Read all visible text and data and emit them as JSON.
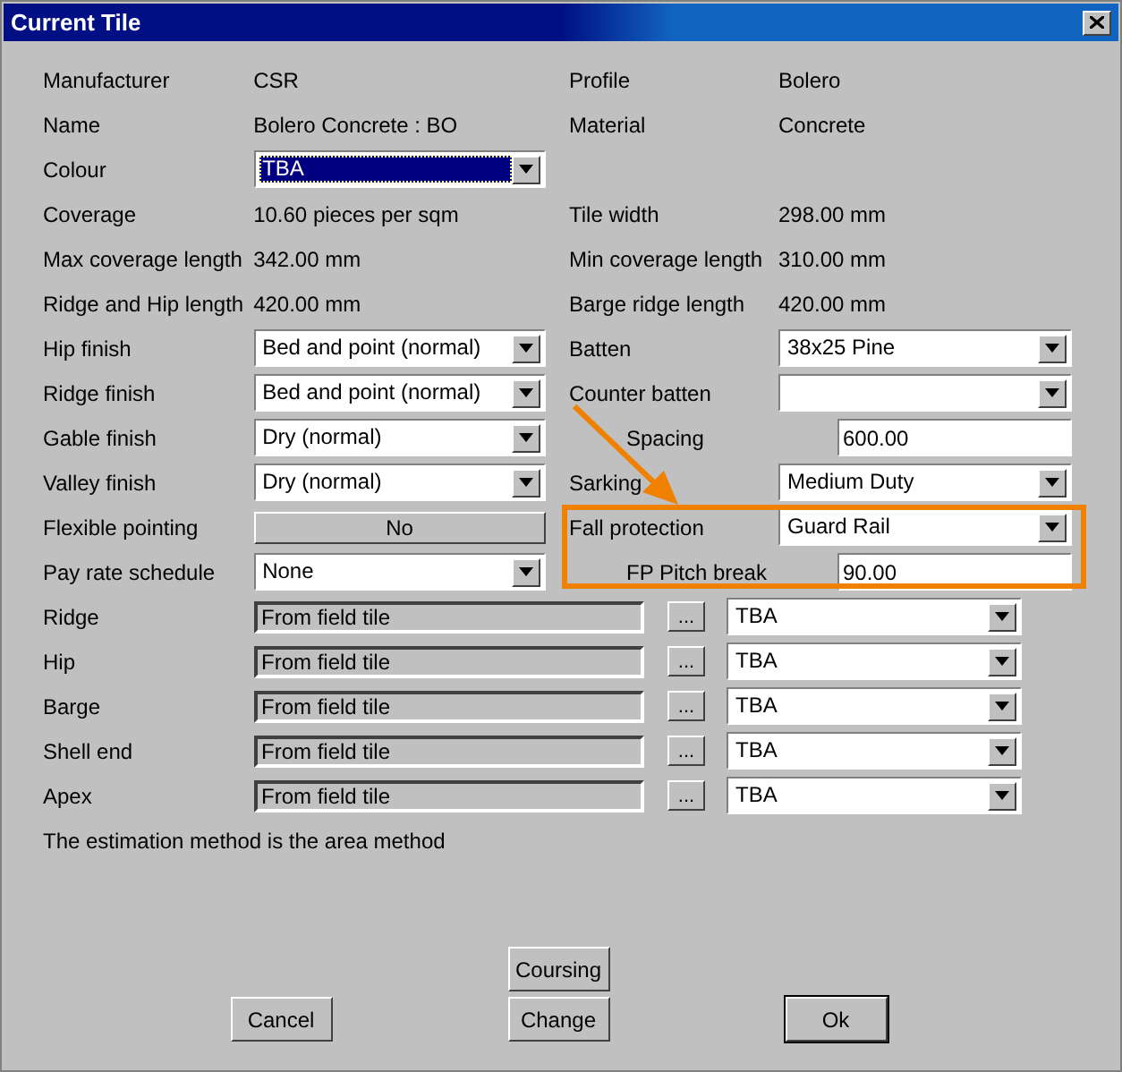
{
  "window": {
    "title": "Current Tile"
  },
  "rows": [
    {
      "left": {
        "label": "Manufacturer",
        "kind": "text",
        "value": "CSR"
      },
      "right": {
        "label": "Profile",
        "kind": "text",
        "value": "Bolero"
      }
    },
    {
      "left": {
        "label": "Name",
        "kind": "text",
        "value": "Bolero Concrete : BO"
      },
      "right": {
        "label": "Material",
        "kind": "text",
        "value": "Concrete"
      }
    },
    {
      "left": {
        "label": "Colour",
        "kind": "select",
        "value": "TBA",
        "focused": true
      }
    },
    {
      "left": {
        "label": "Coverage",
        "kind": "text",
        "value": "10.60 pieces per sqm"
      },
      "right": {
        "label": "Tile width",
        "kind": "text",
        "value": "298.00 mm"
      }
    },
    {
      "left": {
        "label": "Max coverage length",
        "kind": "text",
        "value": "342.00 mm"
      },
      "right": {
        "label": "Min coverage length",
        "kind": "text",
        "value": "310.00 mm"
      }
    },
    {
      "left": {
        "label": "Ridge and Hip length",
        "kind": "text",
        "value": "420.00 mm"
      },
      "right": {
        "label": "Barge ridge length",
        "kind": "text",
        "value": "420.00 mm"
      }
    },
    {
      "left": {
        "label": "Hip finish",
        "kind": "select",
        "value": "Bed and point (normal)",
        "focused": false
      },
      "right": {
        "label": "Batten",
        "kind": "select",
        "value": "38x25 Pine",
        "focused": false
      }
    },
    {
      "left": {
        "label": "Ridge finish",
        "kind": "select",
        "value": "Bed and point (normal)",
        "focused": false
      },
      "right": {
        "label": "Counter batten",
        "kind": "select",
        "focused": false
      }
    },
    {
      "left": {
        "label": "Gable finish",
        "kind": "select",
        "value": "Dry (normal)",
        "focused": false
      },
      "right": {
        "label": "Spacing",
        "kind": "input",
        "value": "600.00"
      }
    },
    {
      "left": {
        "label": "Valley  finish",
        "kind": "select",
        "value": "Dry (normal)",
        "focused": false
      },
      "right": {
        "label": "Sarking",
        "kind": "select",
        "value": "Medium Duty",
        "focused": false
      }
    },
    {
      "left": {
        "label": "Flexible pointing",
        "kind": "toggle",
        "value": "No"
      },
      "right": {
        "label": "Fall protection",
        "kind": "select",
        "value": "Guard Rail",
        "focused": false
      }
    },
    {
      "left": {
        "label": "Pay rate schedule",
        "kind": "select",
        "value": "None",
        "focused": false
      },
      "right": {
        "label": "FP Pitch break",
        "kind": "input",
        "value": "90.00"
      }
    }
  ],
  "fall_protection_callout": true,
  "tile_parts": [
    {
      "label": "Ridge",
      "source": "From field tile",
      "browse": "...",
      "colour": "TBA"
    },
    {
      "label": "Hip",
      "source": "From field tile",
      "browse": "...",
      "colour": "TBA"
    },
    {
      "label": "Barge",
      "source": "From field tile",
      "browse": "...",
      "colour": "TBA"
    },
    {
      "label": "Shell end",
      "source": "From field tile",
      "browse": "...",
      "colour": "TBA"
    },
    {
      "label": "Apex",
      "source": "From field tile",
      "browse": "...",
      "colour": "TBA"
    }
  ],
  "note": "The estimation method is the area method",
  "buttons": [
    {
      "label": "Coursing",
      "kind": "secondary",
      "default": false
    },
    {
      "label": "Cancel",
      "kind": "primary",
      "default": false
    },
    {
      "label": "Change",
      "kind": "primary",
      "default": false
    },
    {
      "label": "Ok",
      "kind": "primary",
      "default": true
    }
  ]
}
